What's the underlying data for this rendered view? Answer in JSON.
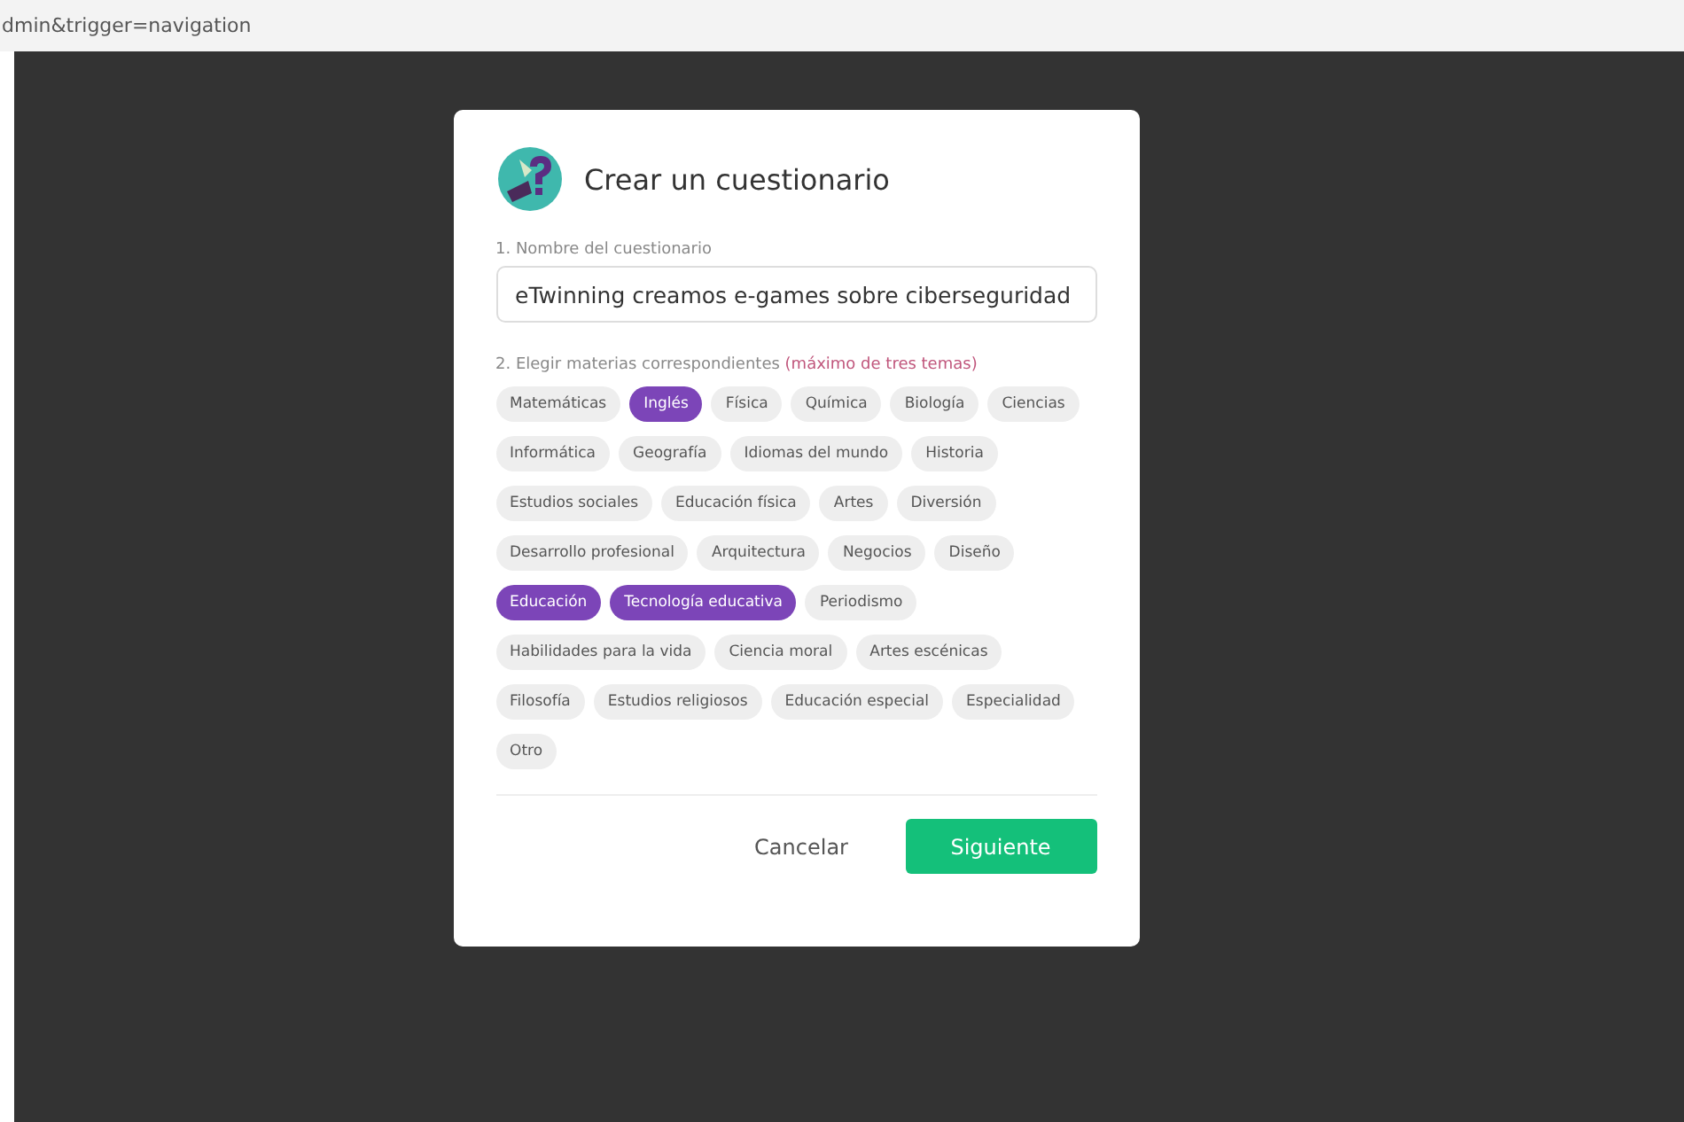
{
  "address_bar": {
    "url": "dmin&trigger=navigation"
  },
  "dialog": {
    "title": "Crear un cuestionario",
    "name_field": {
      "label": "1. Nombre del cuestionario",
      "value": "eTwinning creamos e-games sobre ciberseguridad"
    },
    "subjects": {
      "label": "2. Elegir materias correspondientes",
      "hint": "(máximo de tres temas)",
      "items": [
        {
          "label": "Matemáticas",
          "selected": false
        },
        {
          "label": "Inglés",
          "selected": true
        },
        {
          "label": "Física",
          "selected": false
        },
        {
          "label": "Química",
          "selected": false
        },
        {
          "label": "Biología",
          "selected": false
        },
        {
          "label": "Ciencias",
          "selected": false
        },
        {
          "label": "Informática",
          "selected": false
        },
        {
          "label": "Geografía",
          "selected": false
        },
        {
          "label": "Idiomas del mundo",
          "selected": false
        },
        {
          "label": "Historia",
          "selected": false
        },
        {
          "label": "Estudios sociales",
          "selected": false
        },
        {
          "label": "Educación física",
          "selected": false
        },
        {
          "label": "Artes",
          "selected": false
        },
        {
          "label": "Diversión",
          "selected": false
        },
        {
          "label": "Desarrollo profesional",
          "selected": false
        },
        {
          "label": "Arquitectura",
          "selected": false
        },
        {
          "label": "Negocios",
          "selected": false
        },
        {
          "label": "Diseño",
          "selected": false
        },
        {
          "label": "Educación",
          "selected": true
        },
        {
          "label": "Tecnología educativa",
          "selected": true
        },
        {
          "label": "Periodismo",
          "selected": false
        },
        {
          "label": "Habilidades para la vida",
          "selected": false
        },
        {
          "label": "Ciencia moral",
          "selected": false
        },
        {
          "label": "Artes escénicas",
          "selected": false
        },
        {
          "label": "Filosofía",
          "selected": false
        },
        {
          "label": "Estudios religiosos",
          "selected": false
        },
        {
          "label": "Educación especial",
          "selected": false
        },
        {
          "label": "Especialidad",
          "selected": false
        },
        {
          "label": "Otro",
          "selected": false
        }
      ]
    },
    "buttons": [
      {
        "kind": "secondary",
        "label": "Cancelar"
      },
      {
        "kind": "primary",
        "label": "Siguiente"
      }
    ]
  }
}
